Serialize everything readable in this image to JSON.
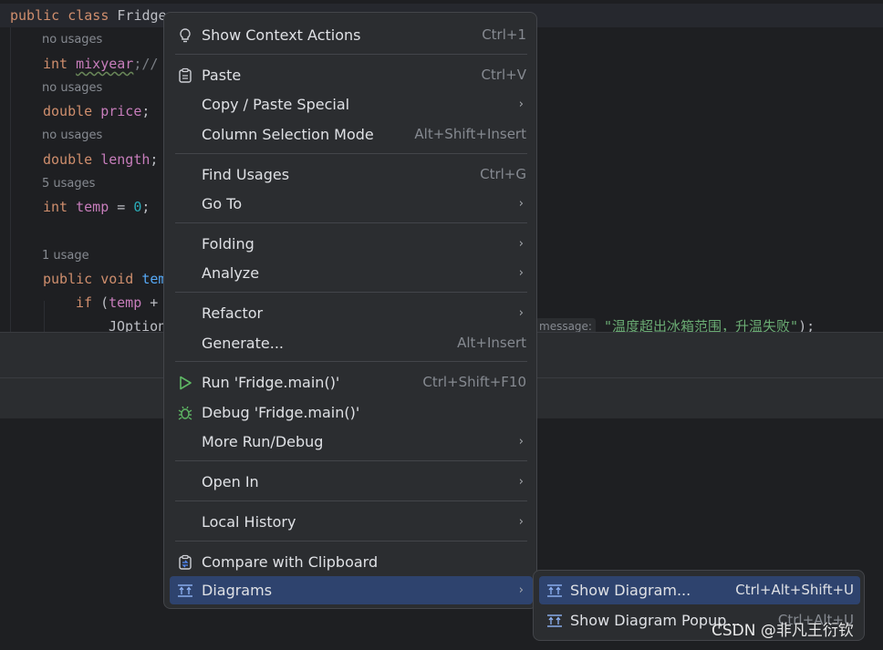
{
  "editor": {
    "line1": {
      "kw": "public class ",
      "name": "Fridge"
    },
    "hint1": "no usages",
    "line2": {
      "kw": "int ",
      "name": "mixyear",
      "rest": ";//"
    },
    "hint2": "no usages",
    "line3": {
      "kw": "double ",
      "name": "price",
      "rest": ";"
    },
    "hint3": "no usages",
    "line4": {
      "kw": "double ",
      "name": "length",
      "rest": ";"
    },
    "hint4": "5 usages",
    "line5": {
      "kw": "int ",
      "name": "temp",
      "eq": " = ",
      "num": "0",
      "rest": ";"
    },
    "hint5": "1 usage",
    "line6": {
      "kw": "public void ",
      "name": "tem"
    },
    "line7": {
      "kw": "if ",
      "rest": "(",
      "name": "temp",
      "op": " +"
    },
    "line8": {
      "text": "JOption"
    },
    "param_hint": "message:",
    "string_literal": "\"温度超出冰箱范围，升温失败\"",
    "string_tail": ");"
  },
  "context_menu": {
    "items": [
      {
        "label": "Show Context Actions",
        "shortcut": "Ctrl+1",
        "icon": "lightbulb-icon"
      },
      {
        "label": "Paste",
        "shortcut": "Ctrl+V",
        "icon": "clipboard-icon"
      },
      {
        "label": "Copy / Paste Special",
        "submenu": true
      },
      {
        "label": "Column Selection Mode",
        "shortcut": "Alt+Shift+Insert"
      },
      {
        "label": "Find Usages",
        "shortcut": "Ctrl+G"
      },
      {
        "label": "Go To",
        "submenu": true
      },
      {
        "label": "Folding",
        "submenu": true
      },
      {
        "label": "Analyze",
        "submenu": true
      },
      {
        "label": "Refactor",
        "submenu": true
      },
      {
        "label": "Generate...",
        "shortcut": "Alt+Insert"
      },
      {
        "label": "Run 'Fridge.main()'",
        "shortcut": "Ctrl+Shift+F10",
        "icon": "run-icon"
      },
      {
        "label": "Debug 'Fridge.main()'",
        "icon": "bug-icon"
      },
      {
        "label": "More Run/Debug",
        "submenu": true
      },
      {
        "label": "Open In",
        "submenu": true
      },
      {
        "label": "Local History",
        "submenu": true
      },
      {
        "label": "Compare with Clipboard",
        "icon": "compare-clipboard-icon"
      },
      {
        "label": "Diagrams",
        "submenu": true,
        "icon": "diagram-icon",
        "selected": true
      }
    ]
  },
  "diagrams_submenu": {
    "items": [
      {
        "label": "Show Diagram...",
        "shortcut": "Ctrl+Alt+Shift+U",
        "icon": "diagram-icon",
        "selected": true
      },
      {
        "label": "Show Diagram Popup...",
        "shortcut": "Ctrl+Alt+U",
        "icon": "diagram-icon"
      }
    ]
  },
  "arrow_glyph": "›",
  "watermark": "CSDN @非凡王衍钦",
  "colors": {
    "menu_bg": "#2b2d30",
    "selected": "#2e436e",
    "editor_bg": "#1e1f22"
  }
}
